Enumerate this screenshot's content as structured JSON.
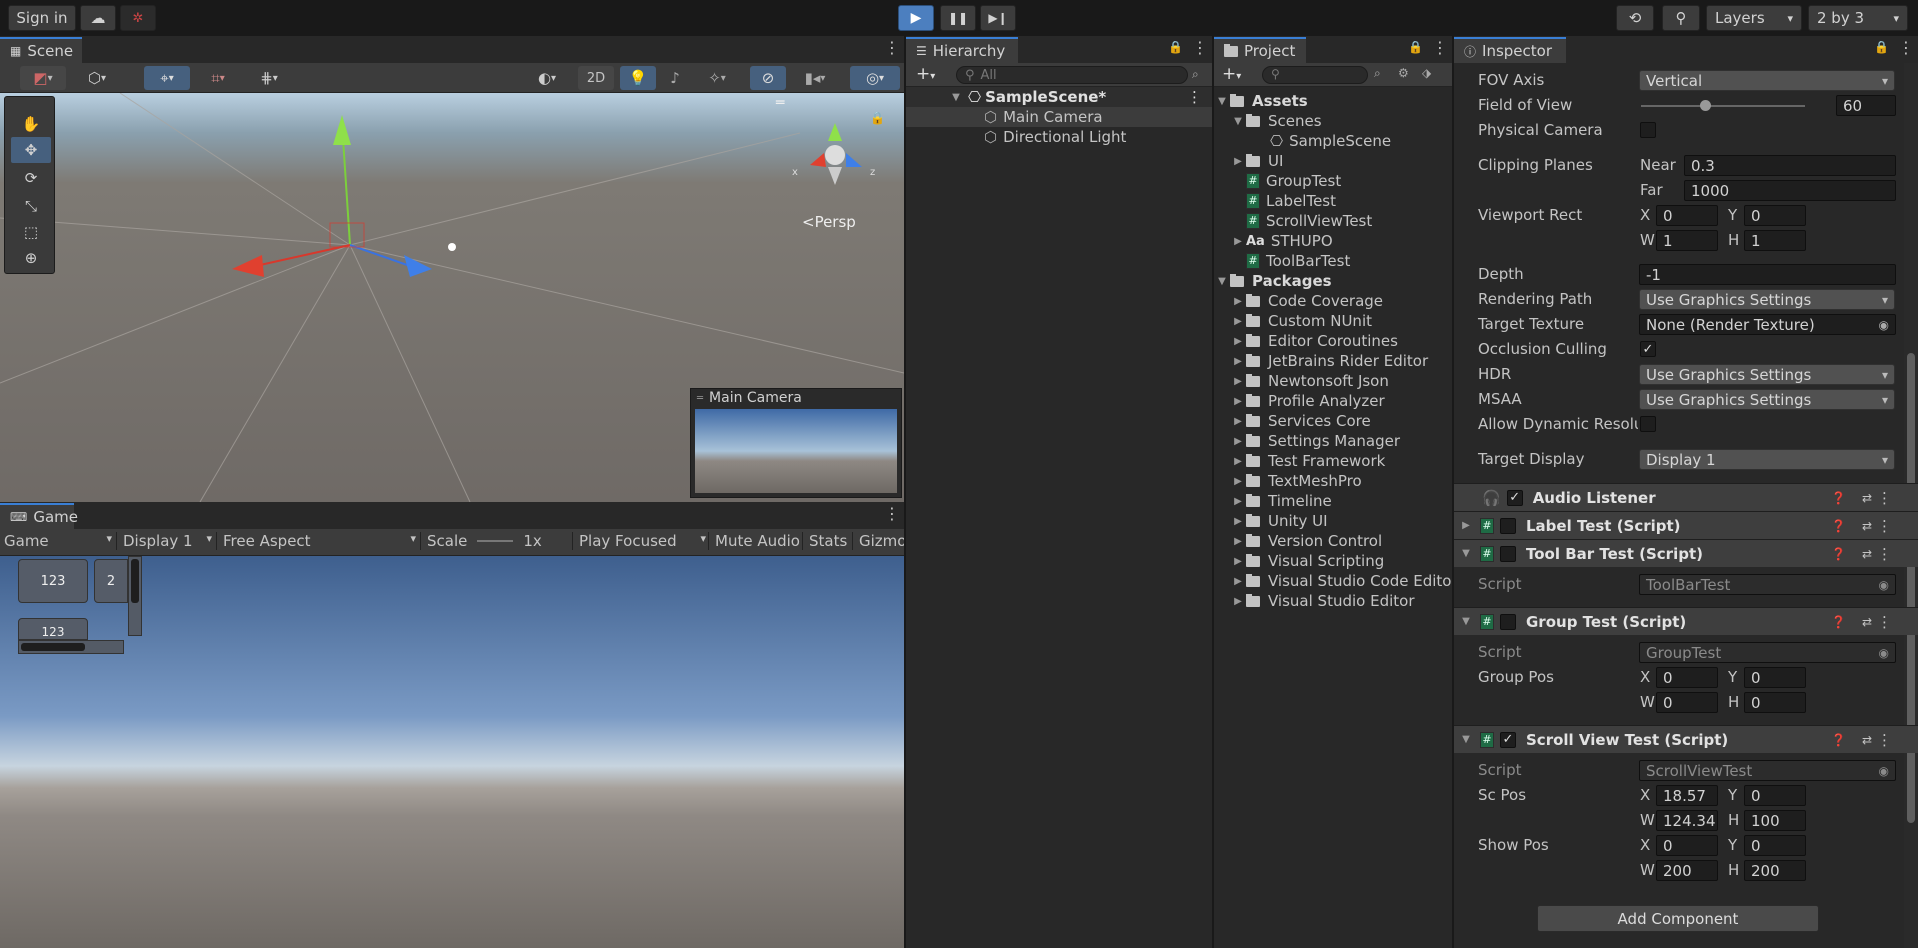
{
  "topbar": {
    "sign_in": "Sign in",
    "layers": "Layers",
    "layout": "2 by 3"
  },
  "scene": {
    "tab": "Scene",
    "btn_2d": "2D",
    "persp": "<Persp",
    "cam_preview_title": "Main Camera"
  },
  "game": {
    "tab": "Game",
    "game_dd": "Game",
    "display": "Display 1",
    "aspect": "Free Aspect",
    "scale_label": "Scale",
    "scale_val": "1x",
    "play_focused": "Play Focused",
    "mute": "Mute Audio",
    "stats": "Stats",
    "gizmos": "Gizmo",
    "btn1": "123",
    "btn2": "2",
    "btn3": "123"
  },
  "hierarchy": {
    "tab": "Hierarchy",
    "search_placeholder": "All",
    "scene": "SampleScene*",
    "items": [
      "Main Camera",
      "Directional Light"
    ]
  },
  "project": {
    "tab": "Project",
    "assets": "Assets",
    "scenes": "Scenes",
    "sample_scene": "SampleScene",
    "asset_items": [
      "UI",
      "GroupTest",
      "LabelTest",
      "ScrollViewTest",
      "STHUPO",
      "ToolBarTest"
    ],
    "packages": "Packages",
    "package_items": [
      "Code Coverage",
      "Custom NUnit",
      "Editor Coroutines",
      "JetBrains Rider Editor",
      "Newtonsoft Json",
      "Profile Analyzer",
      "Services Core",
      "Settings Manager",
      "Test Framework",
      "TextMeshPro",
      "Timeline",
      "Unity UI",
      "Version Control",
      "Visual Scripting",
      "Visual Studio Code Edito",
      "Visual Studio Editor"
    ]
  },
  "inspector": {
    "tab": "Inspector",
    "fov_axis_label": "FOV Axis",
    "fov_axis": "Vertical",
    "fov_label": "Field of View",
    "fov": "60",
    "physical_camera": "Physical Camera",
    "clipping_label": "Clipping Planes",
    "near_label": "Near",
    "near": "0.3",
    "far_label": "Far",
    "far": "1000",
    "viewport_label": "Viewport Rect",
    "vp": {
      "x": "0",
      "y": "0",
      "w": "1",
      "h": "1"
    },
    "depth_label": "Depth",
    "depth": "-1",
    "rendering_path_label": "Rendering Path",
    "rendering_path": "Use Graphics Settings",
    "target_texture_label": "Target Texture",
    "target_texture": "None (Render Texture)",
    "occlusion_label": "Occlusion Culling",
    "hdr_label": "HDR",
    "hdr": "Use Graphics Settings",
    "msaa_label": "MSAA",
    "msaa": "Use Graphics Settings",
    "dyn_res_label": "Allow Dynamic Resolu",
    "target_display_label": "Target Display",
    "target_display": "Display 1",
    "audio_listener": "Audio Listener",
    "label_test": "Label Test (Script)",
    "toolbar_test": "Tool Bar Test (Script)",
    "script_label": "Script",
    "toolbar_script": "ToolBarTest",
    "group_test": "Group Test (Script)",
    "group_script": "GroupTest",
    "group_pos_label": "Group Pos",
    "gp": {
      "x": "0",
      "y": "0",
      "w": "0",
      "h": "0"
    },
    "scroll_test": "Scroll View Test (Script)",
    "scroll_script": "ScrollViewTest",
    "sc_pos_label": "Sc Pos",
    "sp": {
      "x": "18.57",
      "y": "0",
      "w": "124.34",
      "h": "100"
    },
    "show_pos_label": "Show Pos",
    "shp": {
      "x": "0",
      "y": "0",
      "w": "200",
      "h": "200"
    },
    "add_component": "Add Component"
  },
  "colors": {
    "accent": "#3a7fd5",
    "play_active": "#4c7fbf",
    "script_icon": "#1f6b45"
  }
}
